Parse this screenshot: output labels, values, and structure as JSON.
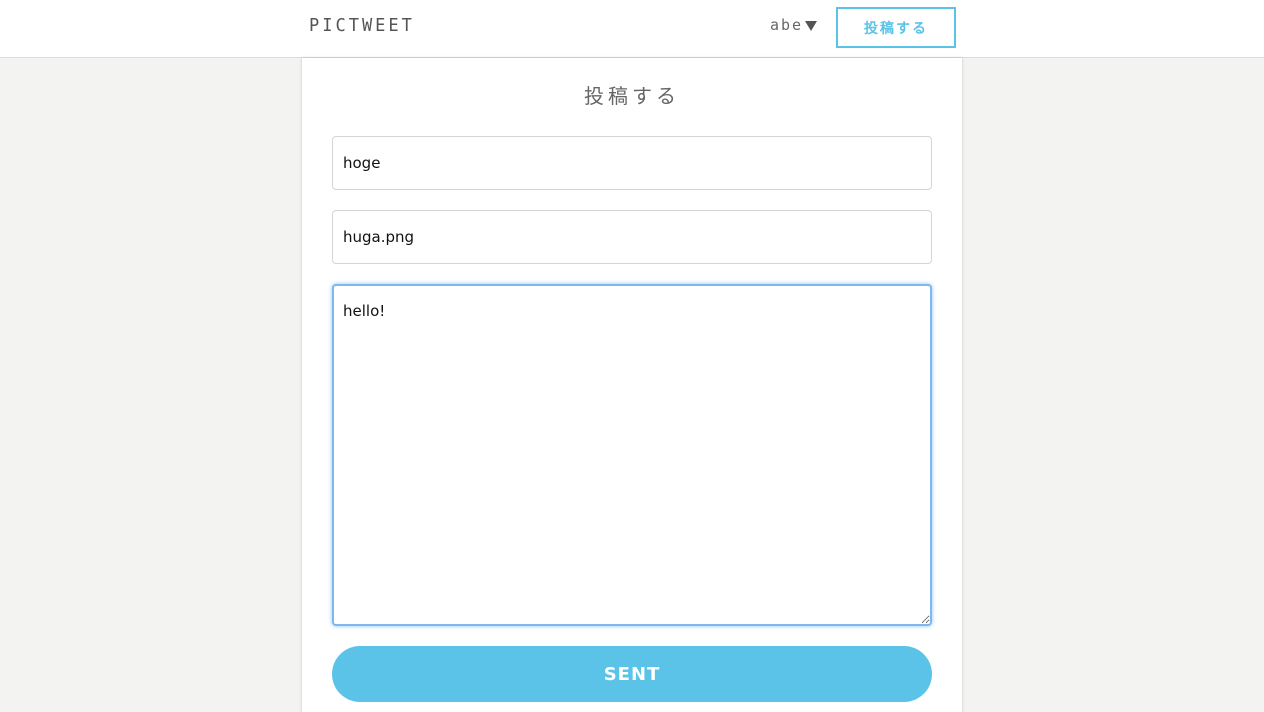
{
  "header": {
    "logo": "pictweet",
    "user_name": "abe",
    "user_menu_icon": "caret-down-icon",
    "post_link_label": "投稿する"
  },
  "form": {
    "title": "投稿する",
    "name_value": "hoge",
    "image_value": "huga.png",
    "text_value": "hello!",
    "submit_label": "SENT"
  },
  "colors": {
    "accent": "#5bc3e8",
    "focus_border": "#7fb8ee",
    "page_background": "#f3f3f2"
  }
}
